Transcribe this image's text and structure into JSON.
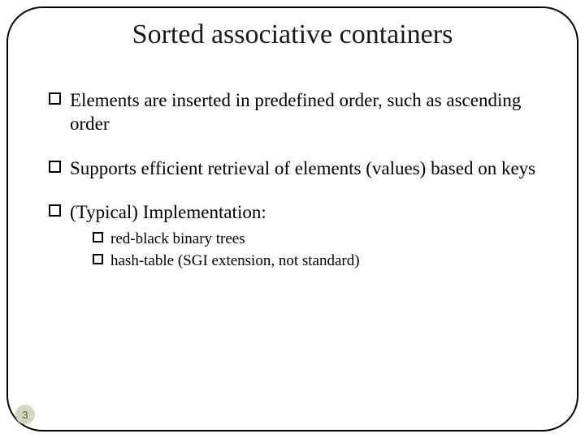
{
  "title": "Sorted associative containers",
  "bullets": {
    "b1": "Elements are inserted in predefined order, such as ascending order",
    "b2": "Supports efficient retrieval of elements (values) based on keys",
    "b3": "(Typical) Implementation:"
  },
  "subbullets": {
    "s1": "red-black binary trees",
    "s2": "hash-table (SGI extension, not standard)"
  },
  "page_number": "3"
}
